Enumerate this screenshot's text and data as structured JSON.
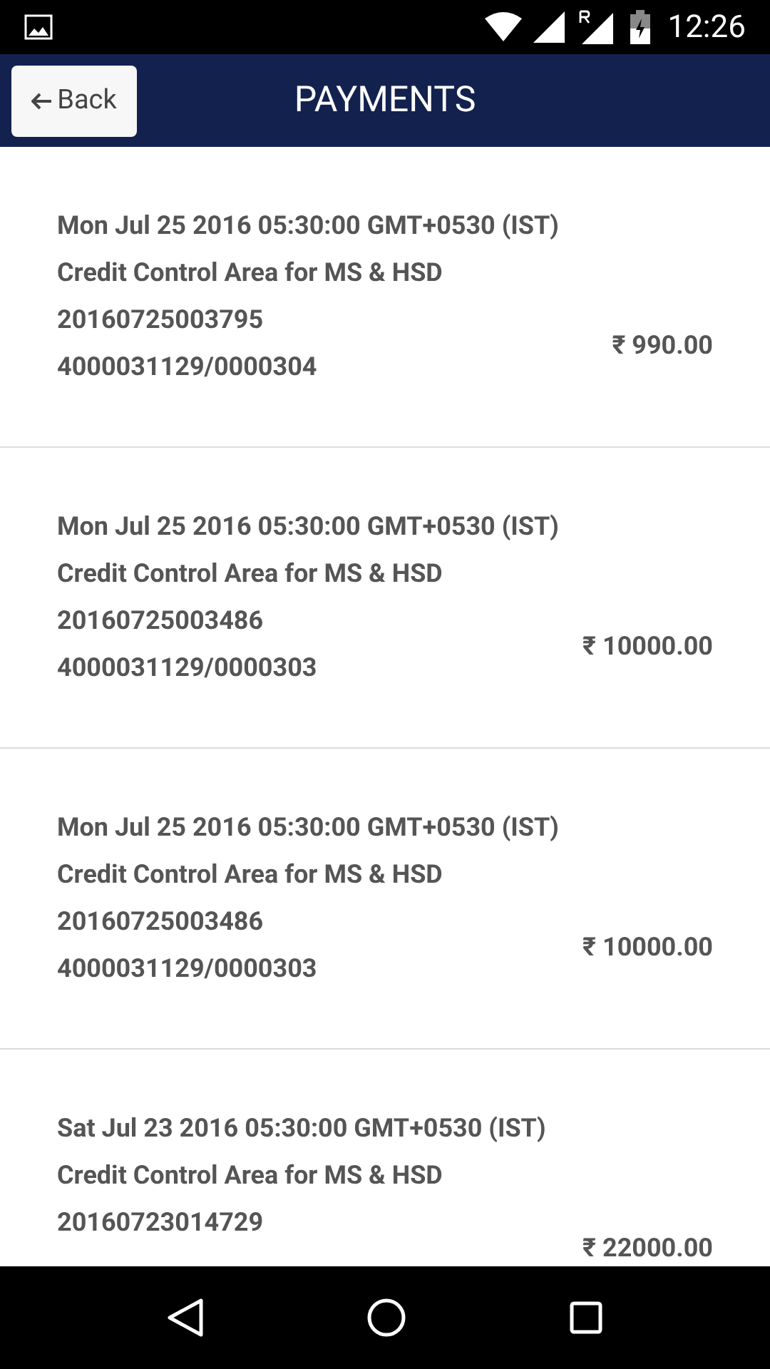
{
  "status_bar": {
    "time": "12:26"
  },
  "header": {
    "back_label": "Back",
    "title": "PAYMENTS"
  },
  "payments": [
    {
      "date": "Mon Jul 25 2016 05:30:00 GMT+0530 (IST)",
      "area": "Credit Control Area for MS & HSD",
      "reference": "20160725003795",
      "document": "4000031129/0000304",
      "amount": "₹ 990.00"
    },
    {
      "date": "Mon Jul 25 2016 05:30:00 GMT+0530 (IST)",
      "area": "Credit Control Area for MS & HSD",
      "reference": "20160725003486",
      "document": "4000031129/0000303",
      "amount": "₹ 10000.00"
    },
    {
      "date": "Mon Jul 25 2016 05:30:00 GMT+0530 (IST)",
      "area": "Credit Control Area for MS & HSD",
      "reference": "20160725003486",
      "document": "4000031129/0000303",
      "amount": "₹ 10000.00"
    },
    {
      "date": "Sat Jul 23 2016 05:30:00 GMT+0530 (IST)",
      "area": "Credit Control Area for MS & HSD",
      "reference": "20160723014729",
      "amount": "₹ 22000.00"
    }
  ]
}
